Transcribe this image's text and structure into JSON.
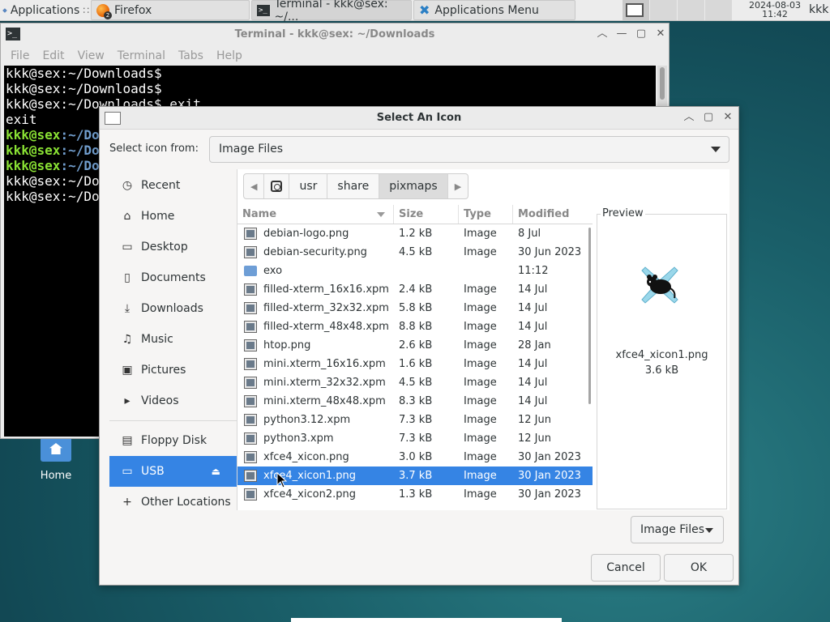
{
  "panel": {
    "apps_label": "Applications",
    "apps_cut": "∷",
    "tasks": [
      {
        "label": "Firefox",
        "badge": "2"
      },
      {
        "label": "Terminal - kkk@sex: ~/..."
      },
      {
        "label": "Applications Menu"
      }
    ],
    "clock_date": "2024-08-03",
    "clock_time": "11:42",
    "user": "kkk"
  },
  "desktop": {
    "home_label": "Home"
  },
  "terminal": {
    "title": "Terminal - kkk@sex: ~/Downloads",
    "menu": [
      "File",
      "Edit",
      "View",
      "Terminal",
      "Tabs",
      "Help"
    ],
    "lines": [
      {
        "plain": "kkk@sex:~/Downloads$"
      },
      {
        "plain": "kkk@sex:~/Downloads$"
      },
      {
        "plain": "kkk@sex:~/Downloads$ exit"
      },
      {
        "plain": "exit"
      },
      {
        "green": "kkk@sex",
        "blue": ":~/Do"
      },
      {
        "green": "kkk@sex",
        "blue": ":~/Do"
      },
      {
        "green": "kkk@sex",
        "blue": ":~/Do"
      },
      {
        "plain": "kkk@sex:~/Do"
      },
      {
        "plain": "kkk@sex:~/Do"
      }
    ]
  },
  "dialog": {
    "title": "Select An Icon",
    "select_from_label": "Select icon from:",
    "select_from_value": "Image Files",
    "places": [
      {
        "label": "Recent",
        "icon": "clock-icon",
        "glyph": "◷"
      },
      {
        "label": "Home",
        "icon": "home-icon",
        "glyph": "⌂"
      },
      {
        "label": "Desktop",
        "icon": "folder-icon",
        "glyph": "▭"
      },
      {
        "label": "Documents",
        "icon": "document-icon",
        "glyph": "▯"
      },
      {
        "label": "Downloads",
        "icon": "download-icon",
        "glyph": "⤓"
      },
      {
        "label": "Music",
        "icon": "music-icon",
        "glyph": "♫"
      },
      {
        "label": "Pictures",
        "icon": "picture-icon",
        "glyph": "▣"
      },
      {
        "label": "Videos",
        "icon": "video-icon",
        "glyph": "▸"
      }
    ],
    "devices": [
      {
        "label": "Floppy Disk",
        "icon": "floppy-icon",
        "glyph": "▤"
      },
      {
        "label": "USB",
        "icon": "usb-drive-icon",
        "glyph": "▭",
        "selected": true,
        "eject": "⏏"
      },
      {
        "label": "Other Locations",
        "icon": "plus-icon",
        "glyph": "+"
      }
    ],
    "breadcrumbs": [
      "usr",
      "share",
      "pixmaps"
    ],
    "columns": {
      "name": "Name",
      "size": "Size",
      "type": "Type",
      "modified": "Modified"
    },
    "files": [
      {
        "name": "debian-logo.png",
        "size": "1.2 kB",
        "type": "Image",
        "modified": "8 Jul"
      },
      {
        "name": "debian-security.png",
        "size": "4.5 kB",
        "type": "Image",
        "modified": "30 Jun 2023"
      },
      {
        "name": "exo",
        "size": "",
        "type": "",
        "modified": "11:12",
        "dir": true
      },
      {
        "name": "filled-xterm_16x16.xpm",
        "size": "2.4 kB",
        "type": "Image",
        "modified": "14 Jul"
      },
      {
        "name": "filled-xterm_32x32.xpm",
        "size": "5.8 kB",
        "type": "Image",
        "modified": "14 Jul"
      },
      {
        "name": "filled-xterm_48x48.xpm",
        "size": "8.8 kB",
        "type": "Image",
        "modified": "14 Jul"
      },
      {
        "name": "htop.png",
        "size": "2.6 kB",
        "type": "Image",
        "modified": "28 Jan"
      },
      {
        "name": "mini.xterm_16x16.xpm",
        "size": "1.6 kB",
        "type": "Image",
        "modified": "14 Jul"
      },
      {
        "name": "mini.xterm_32x32.xpm",
        "size": "4.5 kB",
        "type": "Image",
        "modified": "14 Jul"
      },
      {
        "name": "mini.xterm_48x48.xpm",
        "size": "8.3 kB",
        "type": "Image",
        "modified": "14 Jul"
      },
      {
        "name": "python3.12.xpm",
        "size": "7.3 kB",
        "type": "Image",
        "modified": "12 Jun"
      },
      {
        "name": "python3.xpm",
        "size": "7.3 kB",
        "type": "Image",
        "modified": "12 Jun"
      },
      {
        "name": "xfce4_xicon.png",
        "size": "3.0 kB",
        "type": "Image",
        "modified": "30 Jan 2023"
      },
      {
        "name": "xfce4_xicon1.png",
        "size": "3.7 kB",
        "type": "Image",
        "modified": "30 Jan 2023",
        "selected": true
      },
      {
        "name": "xfce4_xicon2.png",
        "size": "1.3 kB",
        "type": "Image",
        "modified": "30 Jan 2023"
      }
    ],
    "preview": {
      "label": "Preview",
      "name": "xfce4_xicon1.png",
      "size": "3.6 kB"
    },
    "filter_label": "Image Files",
    "cancel_label": "Cancel",
    "ok_label": "OK"
  },
  "colors": {
    "selection": "#3584e4",
    "prompt_green": "#8ae234",
    "prompt_blue": "#729fcf"
  }
}
